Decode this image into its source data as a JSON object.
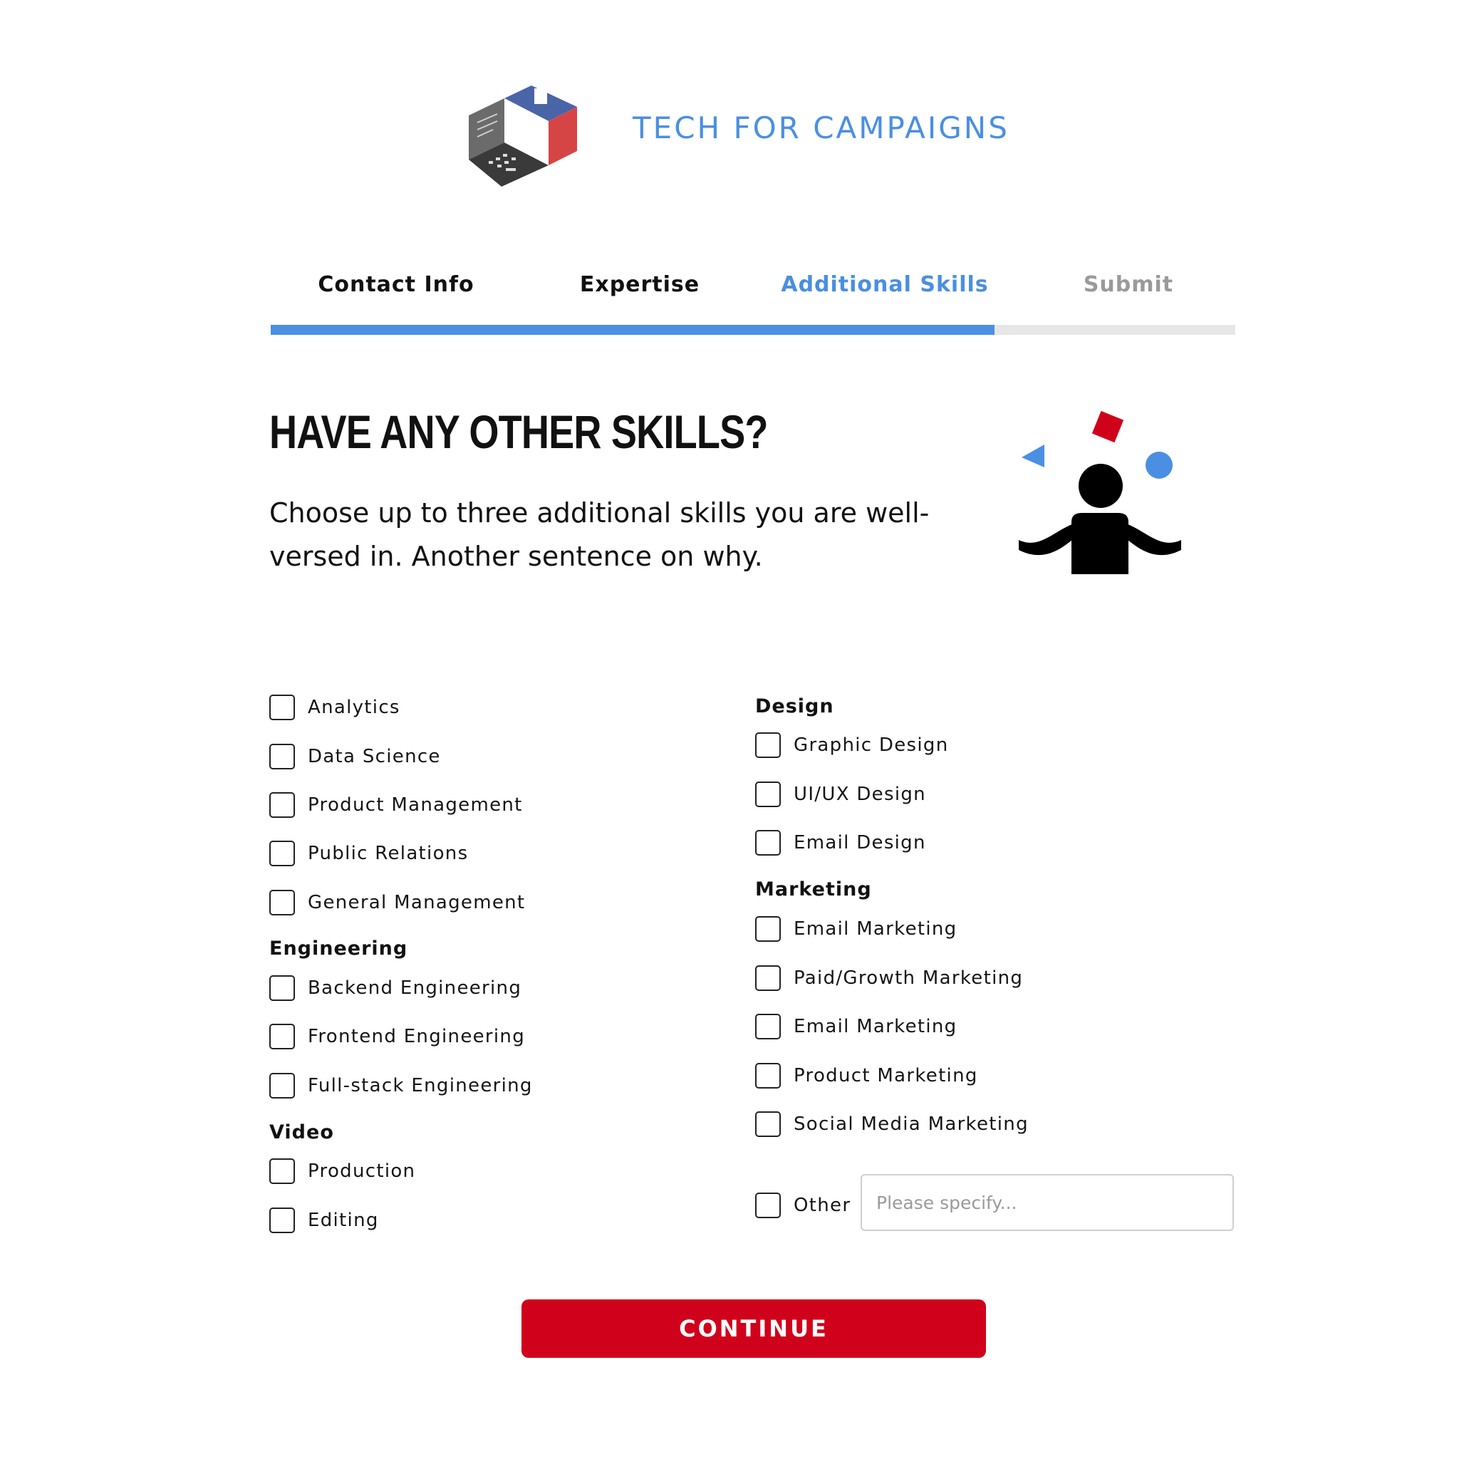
{
  "brand": {
    "name": "TECH FOR CAMPAIGNS"
  },
  "steps": [
    {
      "label": "Contact Info",
      "state": "done"
    },
    {
      "label": "Expertise",
      "state": "done"
    },
    {
      "label": "Additional Skills",
      "state": "current"
    },
    {
      "label": "Submit",
      "state": "todo"
    }
  ],
  "progress": {
    "completed_fraction": 0.75
  },
  "hero": {
    "title": "HAVE ANY OTHER SKILLS?",
    "subtitle": "Choose up to three additional skills you are well-versed in. Another sentence on why."
  },
  "skills": {
    "general": [
      "Analytics",
      "Data Science",
      "Product Management",
      "Public Relations",
      "General Management"
    ],
    "engineering": {
      "heading": "Engineering",
      "items": [
        "Backend Engineering",
        "Frontend Engineering",
        "Full-stack Engineering"
      ]
    },
    "video": {
      "heading": "Video",
      "items": [
        "Production",
        "Editing"
      ]
    },
    "design": {
      "heading": "Design",
      "items": [
        "Graphic Design",
        "UI/UX Design",
        "Email Design"
      ]
    },
    "marketing": {
      "heading": "Marketing",
      "items": [
        "Email Marketing",
        "Paid/Growth Marketing",
        "Email Marketing",
        "Product Marketing",
        "Social Media Marketing"
      ]
    },
    "other": {
      "label": "Other",
      "placeholder": "Please specify..."
    }
  },
  "actions": {
    "continue_label": "CONTINUE"
  },
  "colors": {
    "accent_blue": "#4a8fe2",
    "brand_red": "#d0021b",
    "logo_gray": "#6f6f6f",
    "logo_blue": "#4a64a8",
    "logo_red": "#d64545"
  }
}
